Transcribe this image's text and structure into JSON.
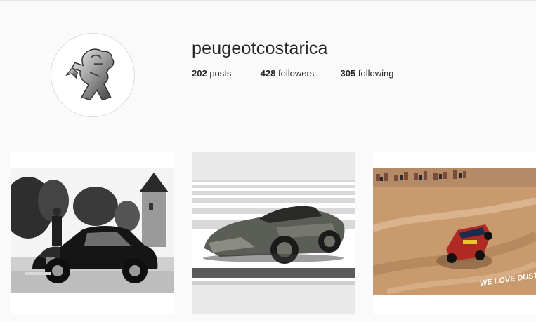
{
  "profile": {
    "username": "peugeotcostarica",
    "avatar_icon": "peugeot-lion-logo",
    "stats": {
      "posts_count": "202",
      "posts_label": "posts",
      "followers_count": "428",
      "followers_label": "followers",
      "following_count": "305",
      "following_label": "following"
    }
  },
  "posts": [
    {
      "icon": "vintage-car-photo"
    },
    {
      "icon": "concept-car-photo"
    },
    {
      "icon": "rally-car-photo",
      "watermark_text": "WE LOVE DUST"
    }
  ]
}
